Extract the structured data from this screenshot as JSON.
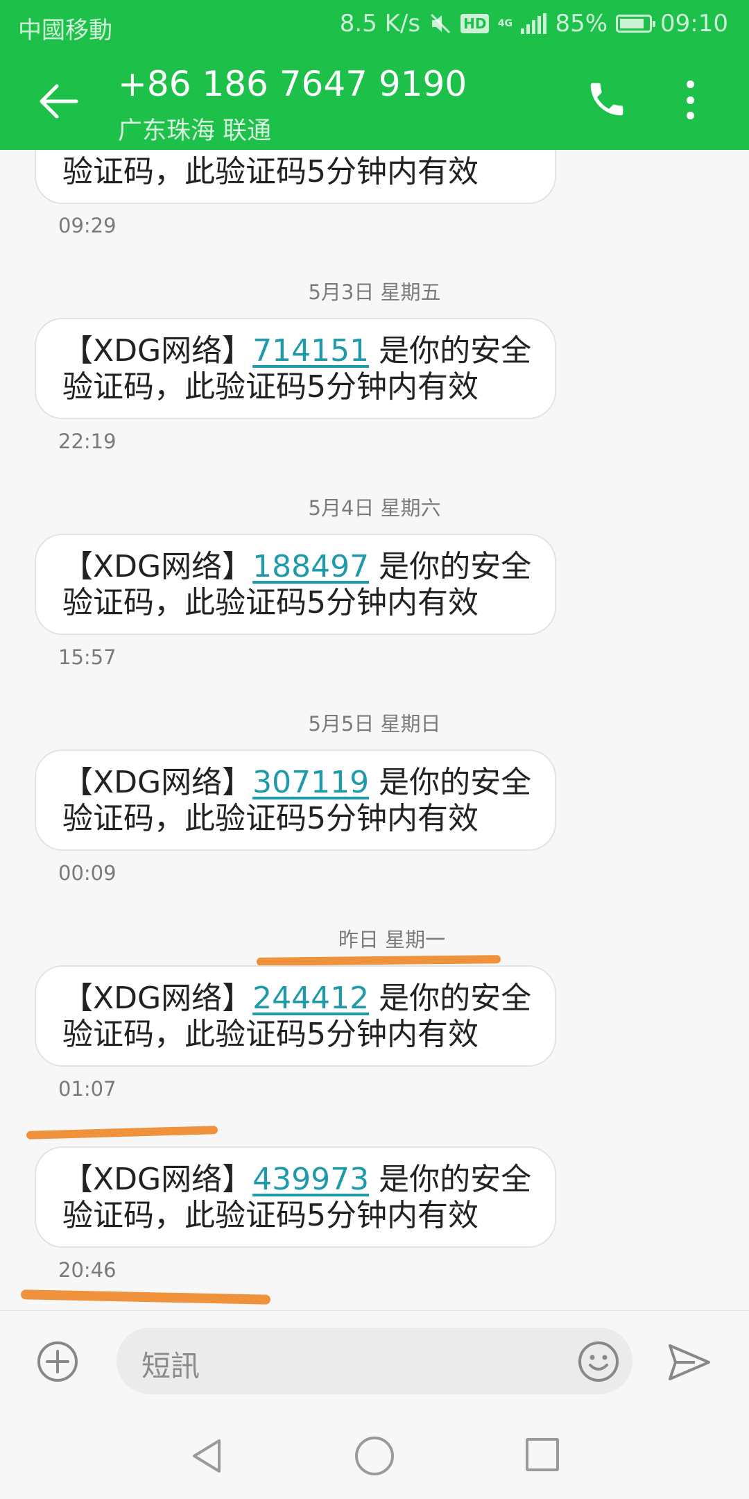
{
  "status_bar": {
    "carrier": "中國移動",
    "speed": "8.5 K/s",
    "hd": "HD",
    "network": "4G",
    "battery": "85%",
    "battery_level": 0.85,
    "time": "09:10"
  },
  "header": {
    "title": "+86 186 7647 9190",
    "subtitle": "广东珠海 联通"
  },
  "messages": [
    {
      "line2": "验证码，此验证码5分钟内有效",
      "time": "09:29"
    },
    {
      "date": "5月3日 星期五",
      "prefix": "【XDG网络】",
      "code": "714151",
      "suffix": " 是你的安全",
      "line2": "验证码，此验证码5分钟内有效",
      "time": "22:19"
    },
    {
      "date": "5月4日 星期六",
      "prefix": "【XDG网络】",
      "code": "188497",
      "suffix": " 是你的安全",
      "line2": "验证码，此验证码5分钟内有效",
      "time": "15:57"
    },
    {
      "date": "5月5日 星期日",
      "prefix": "【XDG网络】",
      "code": "307119",
      "suffix": " 是你的安全",
      "line2": "验证码，此验证码5分钟内有效",
      "time": "00:09"
    },
    {
      "date": "昨日 星期一",
      "prefix": "【XDG网络】",
      "code": "244412",
      "suffix": " 是你的安全",
      "line2": "验证码，此验证码5分钟内有效",
      "time": "01:07"
    },
    {
      "prefix": "【XDG网络】",
      "code": "439973",
      "suffix": " 是你的安全",
      "line2": "验证码，此验证码5分钟内有效",
      "time": "20:46"
    }
  ],
  "composer": {
    "placeholder": "短訊"
  },
  "colors": {
    "accent": "#1dc14a",
    "link": "#1f9aa8",
    "annotation": "#f0913c"
  },
  "icons": [
    "back-arrow-icon",
    "phone-icon",
    "more-vert-icon",
    "add-circle-icon",
    "emoji-icon",
    "send-icon",
    "nav-back-icon",
    "nav-home-icon",
    "nav-recents-icon"
  ]
}
